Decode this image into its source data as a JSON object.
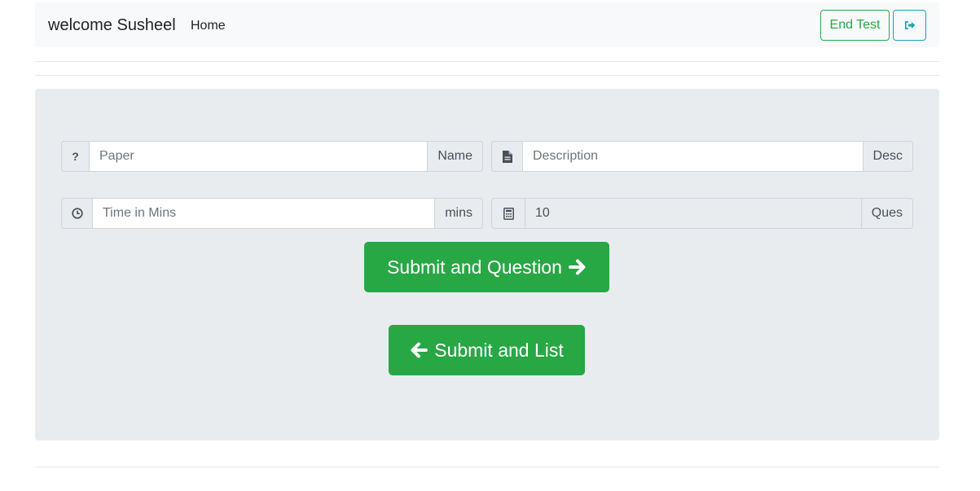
{
  "navbar": {
    "brand": "welcome Susheel",
    "home_link": "Home",
    "end_test_label": "End Test",
    "exit_icon": "sign-out-icon"
  },
  "form": {
    "paper": {
      "icon": "question-icon",
      "icon_text": "?",
      "placeholder": "Paper",
      "value": "",
      "suffix": "Name"
    },
    "description": {
      "icon": "file-text-icon",
      "placeholder": "Description",
      "value": "",
      "suffix": "Desc"
    },
    "time": {
      "icon": "clock-icon",
      "placeholder": "Time in Mins",
      "value": "",
      "suffix": "mins"
    },
    "questions": {
      "icon": "calculator-icon",
      "value": "10",
      "suffix": "Ques"
    }
  },
  "actions": {
    "submit_question_label": "Submit and Question",
    "submit_list_label": "Submit and List"
  },
  "colors": {
    "success": "#28a745",
    "info": "#17a2b8",
    "navbar_bg": "#f8f9fa",
    "jumbotron_bg": "#e9ecef"
  }
}
